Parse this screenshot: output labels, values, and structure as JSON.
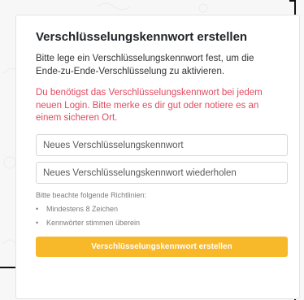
{
  "dialog": {
    "title": "Verschlüsselungskennwort erstellen",
    "description": "Bitte lege ein Verschlüsselungskennwort fest, um die Ende-zu-Ende-Verschlüsselung zu aktivieren.",
    "warning": "Du benötigst das Verschlüsselungskennwort bei jedem neuen Login. Bitte merke es dir gut oder notiere es an einem sicheren Ort.",
    "password_placeholder": "Neues Verschlüsselungskennwort",
    "password_repeat_placeholder": "Neues Verschlüsselungskennwort wiederholen",
    "guidelines_title": "Bitte beachte folgende Richtlinien:",
    "guidelines": [
      {
        "bullet": "•",
        "text": "Mindestens 8 Zeichen"
      },
      {
        "bullet": "•",
        "text": "Kennwörter stimmen überein"
      }
    ],
    "submit_label": "Verschlüsselungskennwort erstellen"
  },
  "colors": {
    "accent": "#f7b82a",
    "warning": "#e04a5f",
    "background": "#f7f7f7"
  }
}
